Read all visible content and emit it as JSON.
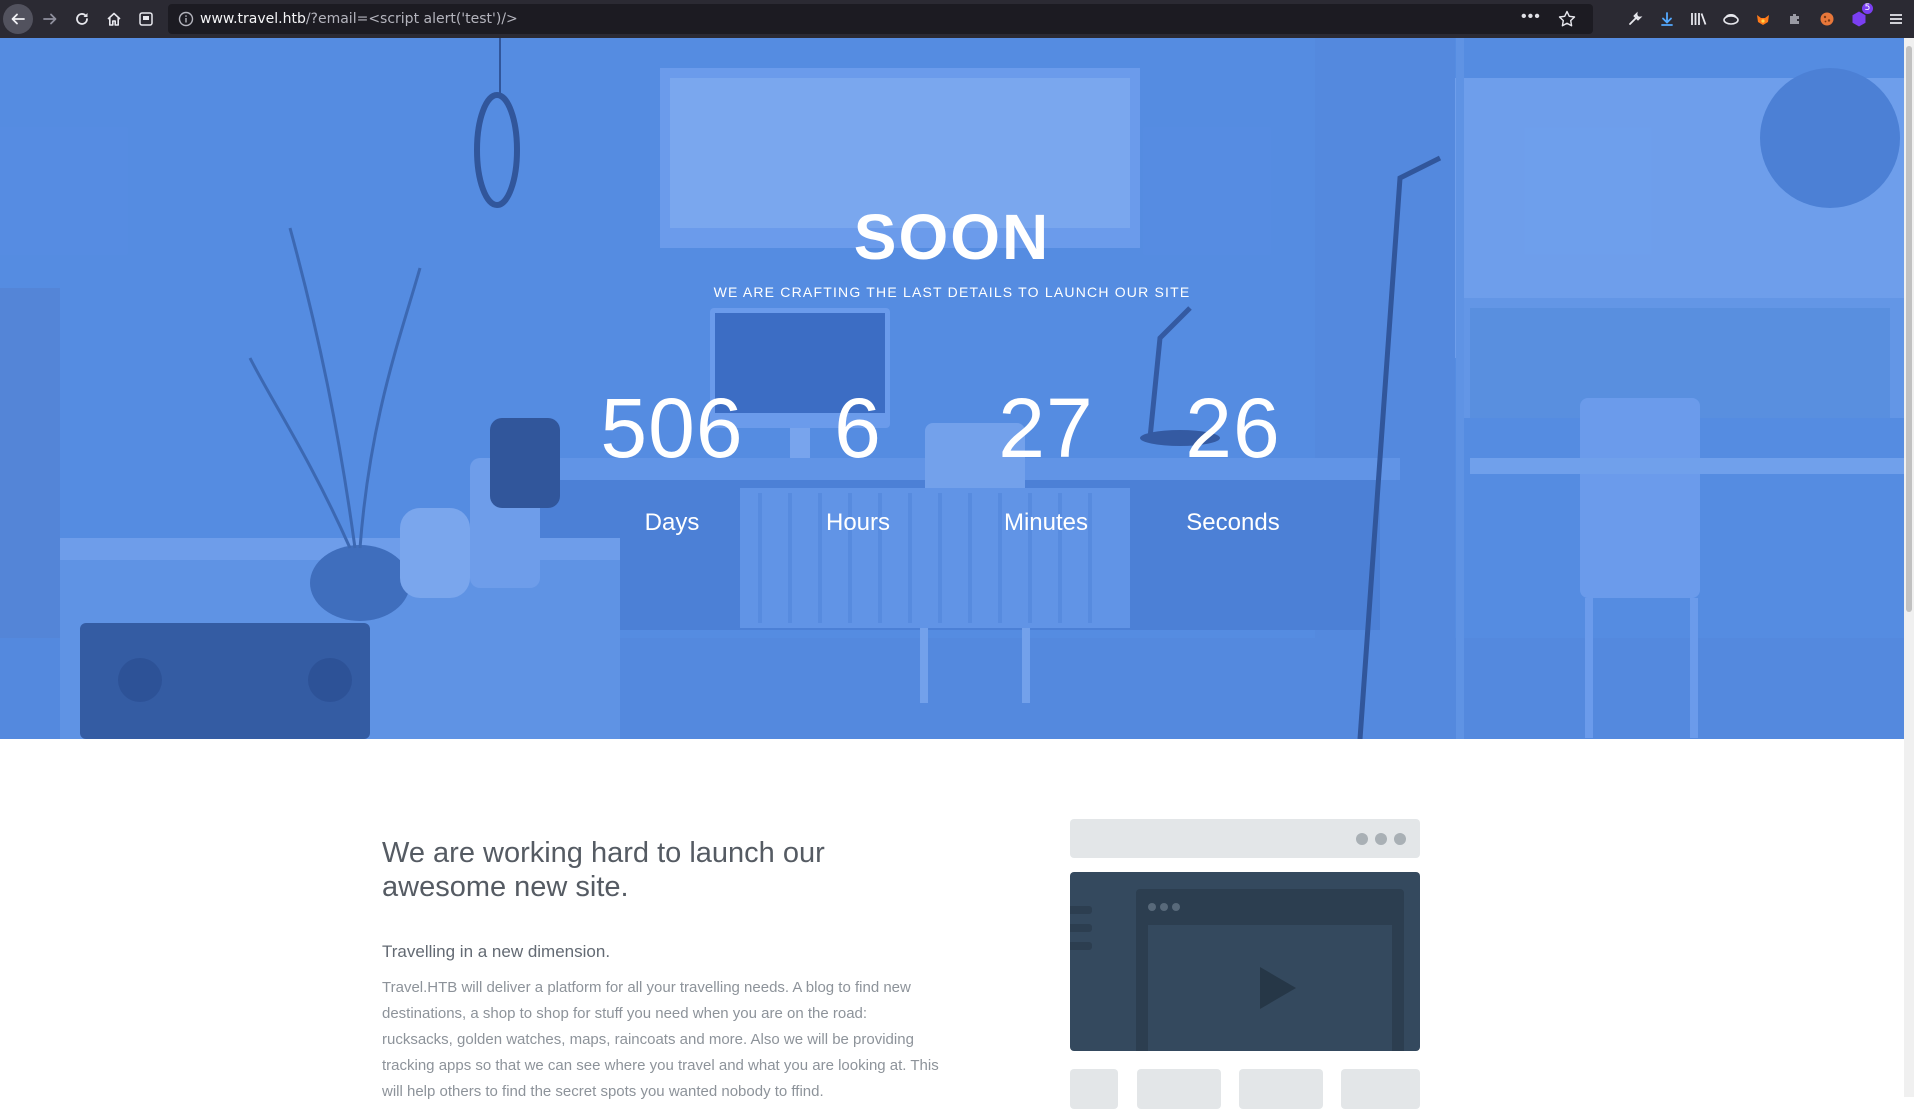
{
  "browser": {
    "url_host": "www.travel.htb",
    "url_rest": "/?email=<script alert('test')/>",
    "more_menu_label": "•••",
    "extensions_badge_count": "5",
    "icons": [
      "back-arrow-icon",
      "forward-arrow-icon",
      "reload-icon",
      "home-icon",
      "reader-view-icon",
      "site-info-icon",
      "more-icon",
      "bookmark-star-icon",
      "wrench-icon",
      "downloads-icon",
      "library-icon",
      "extension-icon",
      "fox-extension-icon",
      "puzzle-extension-icon",
      "cookie-extension-icon",
      "hex-extension-icon",
      "hamburger-menu-icon"
    ]
  },
  "hero": {
    "title": "SOON",
    "subtitle": "WE ARE CRAFTING THE LAST DETAILS TO LAUNCH OUR SITE",
    "countdown": [
      {
        "value": "506",
        "label": "Days"
      },
      {
        "value": "6",
        "label": "Hours"
      },
      {
        "value": "27",
        "label": "Minutes"
      },
      {
        "value": "26",
        "label": "Seconds"
      }
    ],
    "overlay_color": "#5b8fe0"
  },
  "content": {
    "heading": "We are working hard to launch our awesome new site.",
    "subheading": "Travelling in a new dimension.",
    "body": "Travel.HTB will deliver a platform for all your travelling needs. A blog to find new destinations, a shop to shop for stuff you need when you are on the road: rucksacks, golden watches, maps, raincoats and more. Also we will be providing tracking apps so that we can see where you travel and what you are looking at. This will help others to find the secret spots you wanted nobody to ffind."
  },
  "illustration": {
    "icon": "play-icon",
    "screen_color": "#34495e"
  }
}
